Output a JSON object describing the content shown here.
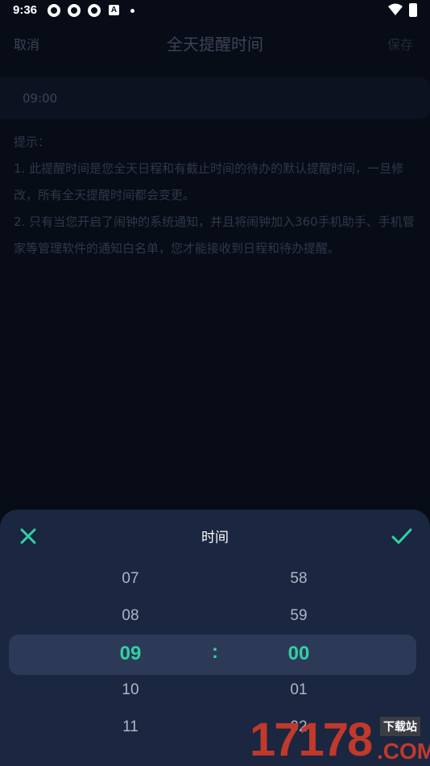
{
  "status_bar": {
    "time": "9:36",
    "icons": [
      "app-notification-icon",
      "app-notification-icon",
      "app-notification-icon",
      "a-app-icon",
      "dot-icon",
      "wifi-icon",
      "battery-charging-icon"
    ],
    "a_icon_letter": "A"
  },
  "header": {
    "cancel_label": "取消",
    "title": "全天提醒时间",
    "save_label": "保存"
  },
  "reminder_time": {
    "value": "09:00"
  },
  "tips": {
    "heading": "提示：",
    "line1": " 1. 此提醒时间是您全天日程和有截止时间的待办的默认提醒时间，一旦修改，所有全天提醒时间都会变更。",
    "line2": " 2. 只有当您开启了闹钟的系统通知，并且将闹钟加入360手机助手、手机管家等管理软件的通知白名单，您才能接收到日程和待办提醒。"
  },
  "picker": {
    "title": "时间",
    "close_icon": "close-icon",
    "confirm_icon": "check-icon",
    "accent_color": "#30d1a7",
    "hours": [
      "07",
      "08",
      "09",
      "10",
      "11"
    ],
    "minutes": [
      "58",
      "59",
      "00",
      "01",
      "02"
    ],
    "separator": ":",
    "selected_hour": "09",
    "selected_minute": "00"
  },
  "watermark": {
    "digits": "17178",
    "badge": "下载站",
    "domain": ".COM"
  }
}
